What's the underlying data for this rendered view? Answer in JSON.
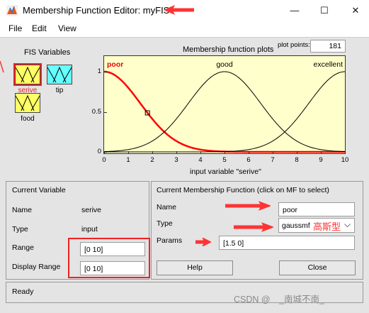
{
  "window": {
    "title": "Membership Function Editor: myFIS",
    "minimize_glyph": "—",
    "maximize_glyph": "☐",
    "close_glyph": "✕"
  },
  "menu": [
    "File",
    "Edit",
    "View"
  ],
  "fis_variables": {
    "label": "FIS Variables",
    "inputs": [
      {
        "name": "serive",
        "color": "#ffff66",
        "selected": true
      },
      {
        "name": "food",
        "color": "#ffff66",
        "selected": false
      }
    ],
    "outputs": [
      {
        "name": "tip",
        "color": "#66ffff",
        "selected": false
      }
    ]
  },
  "plot": {
    "title": "Membership function plots",
    "plot_points_label": "plot points:",
    "plot_points_value": "181",
    "xlabel": "input variable \"serive\"",
    "x_ticks": [
      "0",
      "1",
      "2",
      "3",
      "4",
      "5",
      "6",
      "7",
      "8",
      "9",
      "10"
    ],
    "y_ticks": [
      "0",
      "0.5",
      "1"
    ],
    "mf_labels": [
      "poor",
      "good",
      "excellent"
    ]
  },
  "chart_data": {
    "type": "line",
    "xlim": [
      0,
      10
    ],
    "ylim": [
      0,
      1
    ],
    "x_ticks": [
      0,
      1,
      2,
      3,
      4,
      5,
      6,
      7,
      8,
      9,
      10
    ],
    "y_ticks": [
      0,
      0.5,
      1
    ],
    "xlabel": "input variable \"serive\"",
    "title": "Membership function plots",
    "series": [
      {
        "name": "poor",
        "kind": "gaussmf",
        "sigma": 1.5,
        "center": 0,
        "color": "#ff0000",
        "selected": true
      },
      {
        "name": "good",
        "kind": "gaussmf",
        "sigma": 1.5,
        "center": 5,
        "color": "#000000",
        "selected": false
      },
      {
        "name": "excellent",
        "kind": "gaussmf",
        "sigma": 1.5,
        "center": 10,
        "color": "#000000",
        "selected": false
      }
    ],
    "grid": false
  },
  "current_variable": {
    "title": "Current Variable",
    "name_label": "Name",
    "name_value": "serive",
    "type_label": "Type",
    "type_value": "input",
    "range_label": "Range",
    "range_value": "[0 10]",
    "display_range_label": "Display Range",
    "display_range_value": "[0 10]"
  },
  "current_mf": {
    "title": "Current Membership Function (click on MF to select)",
    "name_label": "Name",
    "name_value": "poor",
    "type_label": "Type",
    "type_value": "gaussmf",
    "type_annotation": "高斯型",
    "params_label": "Params",
    "params_value": "[1.5 0]"
  },
  "buttons": {
    "help": "Help",
    "close": "Close"
  },
  "status": {
    "text": "Ready"
  },
  "watermark": "CSDN @　_南城不南_",
  "accent_colors": {
    "annotation_red": "#ff3333",
    "selection_red": "#ee2222"
  }
}
